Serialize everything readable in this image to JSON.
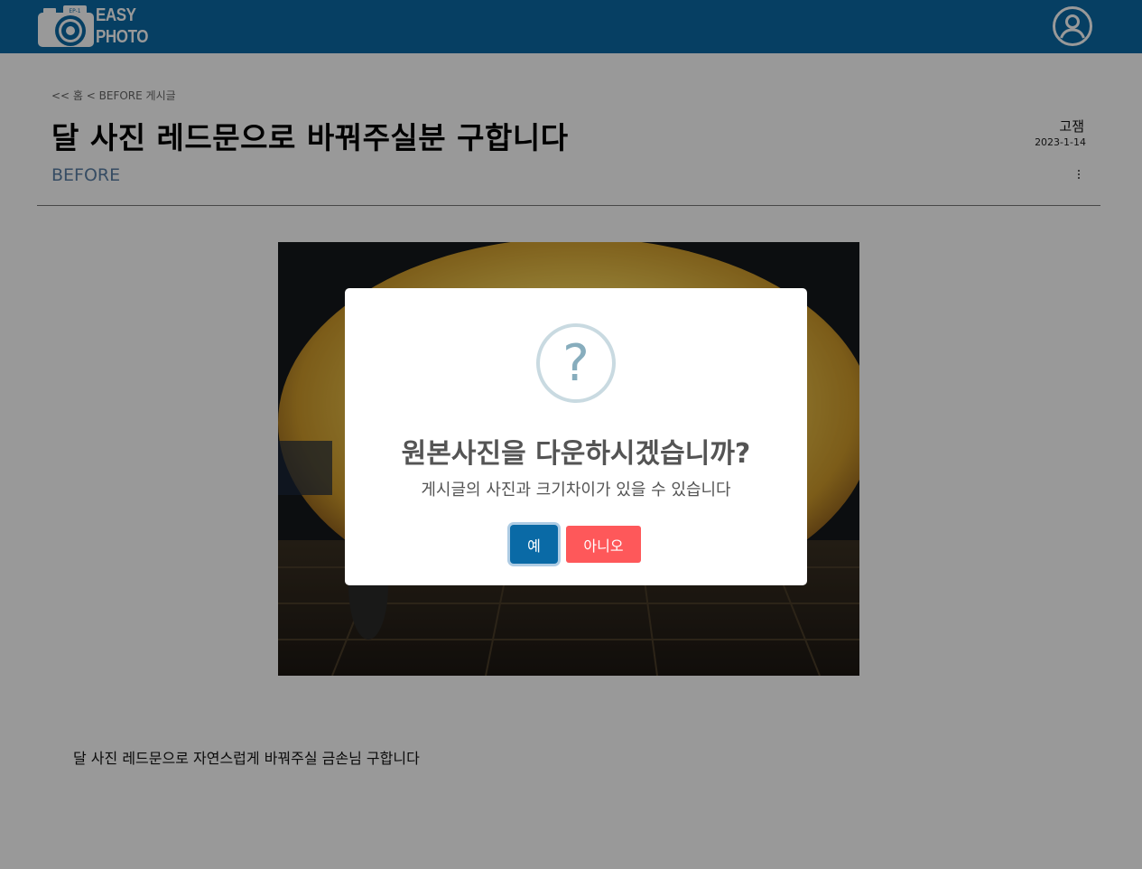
{
  "header": {
    "logo_line1": "EASY",
    "logo_line2": "PHOTO",
    "profile_icon": "user-circle-icon",
    "colors": {
      "bar": "#0a6aa6"
    }
  },
  "post": {
    "breadcrumb": "<< 홈 < BEFORE 게시글",
    "title": "달 사진 레드문으로 바꿔주실분 구합니다",
    "category": "BEFORE",
    "author": "고잼",
    "date": "2023-1-14",
    "more_icon": "vertical-ellipsis-icon",
    "body": "달 사진 레드문으로 자연스럽게 바꿔주실 금손님 구합니다"
  },
  "modal": {
    "icon": "question-icon",
    "icon_glyph": "?",
    "title": "원본사진을 다운하시겠습니까?",
    "text": "게시글의 사진과 크기차이가 있을 수 있습니다",
    "confirm_label": "예",
    "cancel_label": "아니오",
    "colors": {
      "confirm": "#0a6aa6",
      "cancel": "#fe585a"
    }
  }
}
